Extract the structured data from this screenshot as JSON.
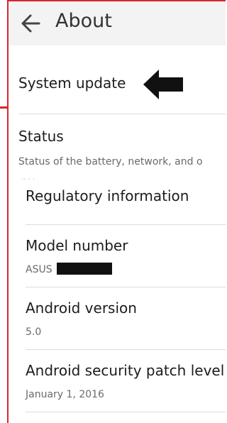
{
  "header": {
    "title": "About",
    "back_icon": "arrow-left-icon"
  },
  "items": [
    {
      "label": "System update"
    },
    {
      "label": "Status",
      "summary": "Status of the battery, network, and o"
    },
    {
      "label": "Regulatory information"
    },
    {
      "label": "Model number",
      "summary": "ASUS"
    },
    {
      "label": "Android version",
      "summary": "5.0"
    },
    {
      "label": "Android security patch level",
      "summary": "January 1, 2016"
    }
  ],
  "annotation": {
    "icon": "pointer-arrow-icon",
    "color": "#111111"
  },
  "frame_color": "#d9262c"
}
